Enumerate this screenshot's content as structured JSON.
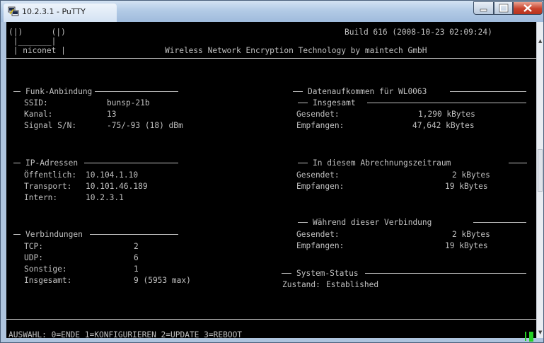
{
  "window": {
    "title": "10.2.3.1 - PuTTY",
    "controls": [
      "minimize-icon",
      "maximize-icon",
      "close-icon"
    ],
    "colors": {
      "terminal_bg": "#000000",
      "terminal_fg": "#c0c0c0",
      "cursor": "#25d025"
    }
  },
  "banner": {
    "logo_line1": "(|)      (|)",
    "logo_line2": " |_______|",
    "logo_line3": " | niconet |",
    "build": "Build 616 (2008-10-23 02:09:24)",
    "tagline": "Wireless Network Encryption Technology by maintech GmbH"
  },
  "funk": {
    "heading": "Funk-Anbindung",
    "ssid_label": "SSID:",
    "ssid_value": "bunsp-21b",
    "kanal_label": "Kanal:",
    "kanal_value": "13",
    "signal_label": "Signal S/N:",
    "signal_value": "-75/-93 (18) dBm"
  },
  "ip": {
    "heading": "IP-Adressen",
    "offentlich_label": "Öffentlich:",
    "offentlich_value": "10.104.1.10",
    "transport_label": "Transport:",
    "transport_value": "10.101.46.189",
    "intern_label": "Intern:",
    "intern_value": "10.2.3.1"
  },
  "verbindungen": {
    "heading": "Verbindungen",
    "tcp_label": "TCP:",
    "tcp_value": "2",
    "udp_label": "UDP:",
    "udp_value": "6",
    "sonstige_label": "Sonstige:",
    "sonstige_value": "1",
    "insgesamt_label": "Insgesamt:",
    "insgesamt_value": "9 (5953 max)"
  },
  "daten": {
    "heading": "Datenaufkommen für WL0063",
    "total_heading": "Insgesamt",
    "total_sent_label": "Gesendet:",
    "total_sent_value": "1,290 kBytes",
    "total_recv_label": "Empfangen:",
    "total_recv_value": "47,642 kBytes",
    "period_heading": "In diesem Abrechnungszeitraum",
    "period_sent_label": "Gesendet:",
    "period_sent_value": "2 kBytes",
    "period_recv_label": "Empfangen:",
    "period_recv_value": "19 kBytes",
    "conn_heading": "Während dieser Verbindung",
    "conn_sent_label": "Gesendet:",
    "conn_sent_value": "2 kBytes",
    "conn_recv_label": "Empfangen:",
    "conn_recv_value": "19 kBytes"
  },
  "status": {
    "heading": "System-Status",
    "zustand_label": "Zustand:",
    "zustand_value": "Established"
  },
  "menu": {
    "prompt": "AUSWAHL: 0=ENDE 1=KONFIGURIEREN 2=UPDATE 3=REBOOT"
  }
}
